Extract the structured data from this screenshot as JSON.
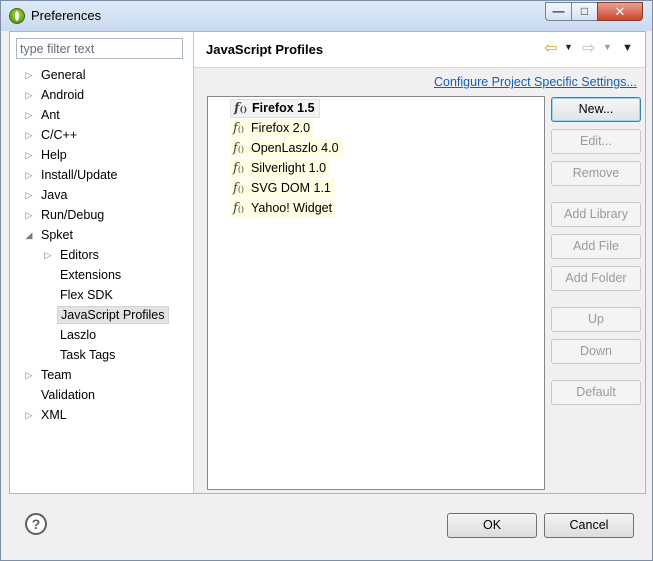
{
  "window": {
    "title": "Preferences",
    "icon": "eclipse-app-icon",
    "controls": {
      "minimize": "—",
      "maximize": "□",
      "close": "✕"
    }
  },
  "left": {
    "filter_placeholder": "type filter text",
    "filter_value": "",
    "tree": [
      {
        "label": "General",
        "level": 0,
        "arrow": "collapsed"
      },
      {
        "label": "Android",
        "level": 0,
        "arrow": "collapsed"
      },
      {
        "label": "Ant",
        "level": 0,
        "arrow": "collapsed"
      },
      {
        "label": "C/C++",
        "level": 0,
        "arrow": "collapsed"
      },
      {
        "label": "Help",
        "level": 0,
        "arrow": "collapsed"
      },
      {
        "label": "Install/Update",
        "level": 0,
        "arrow": "collapsed"
      },
      {
        "label": "Java",
        "level": 0,
        "arrow": "collapsed"
      },
      {
        "label": "Run/Debug",
        "level": 0,
        "arrow": "collapsed"
      },
      {
        "label": "Spket",
        "level": 0,
        "arrow": "expanded"
      },
      {
        "label": "Editors",
        "level": 1,
        "arrow": "collapsed"
      },
      {
        "label": "Extensions",
        "level": 1,
        "arrow": "none"
      },
      {
        "label": "Flex SDK",
        "level": 1,
        "arrow": "none"
      },
      {
        "label": "JavaScript Profiles",
        "level": 1,
        "arrow": "none",
        "selected": true
      },
      {
        "label": "Laszlo",
        "level": 1,
        "arrow": "none"
      },
      {
        "label": "Task Tags",
        "level": 1,
        "arrow": "none"
      },
      {
        "label": "Team",
        "level": 0,
        "arrow": "collapsed"
      },
      {
        "label": "Validation",
        "level": 0,
        "arrow": "none"
      },
      {
        "label": "XML",
        "level": 0,
        "arrow": "collapsed"
      }
    ]
  },
  "right": {
    "title": "JavaScript Profiles",
    "link": "Configure Project Specific Settings...",
    "profiles": [
      {
        "name": "Firefox 1.5",
        "default": true
      },
      {
        "name": "Firefox 2.0"
      },
      {
        "name": "OpenLaszlo 4.0"
      },
      {
        "name": "Silverlight 1.0"
      },
      {
        "name": "SVG DOM 1.1"
      },
      {
        "name": "Yahoo! Widget"
      }
    ],
    "buttons": {
      "new": "New...",
      "edit": "Edit...",
      "remove": "Remove",
      "add_library": "Add Library",
      "add_file": "Add File",
      "add_folder": "Add Folder",
      "up": "Up",
      "down": "Down",
      "default": "Default"
    }
  },
  "footer": {
    "help": "?",
    "ok": "OK",
    "cancel": "Cancel"
  },
  "colors": {
    "link": "#1a5fb4",
    "profile_highlight": "#fffde2",
    "back_arrow": "#d9a322"
  }
}
